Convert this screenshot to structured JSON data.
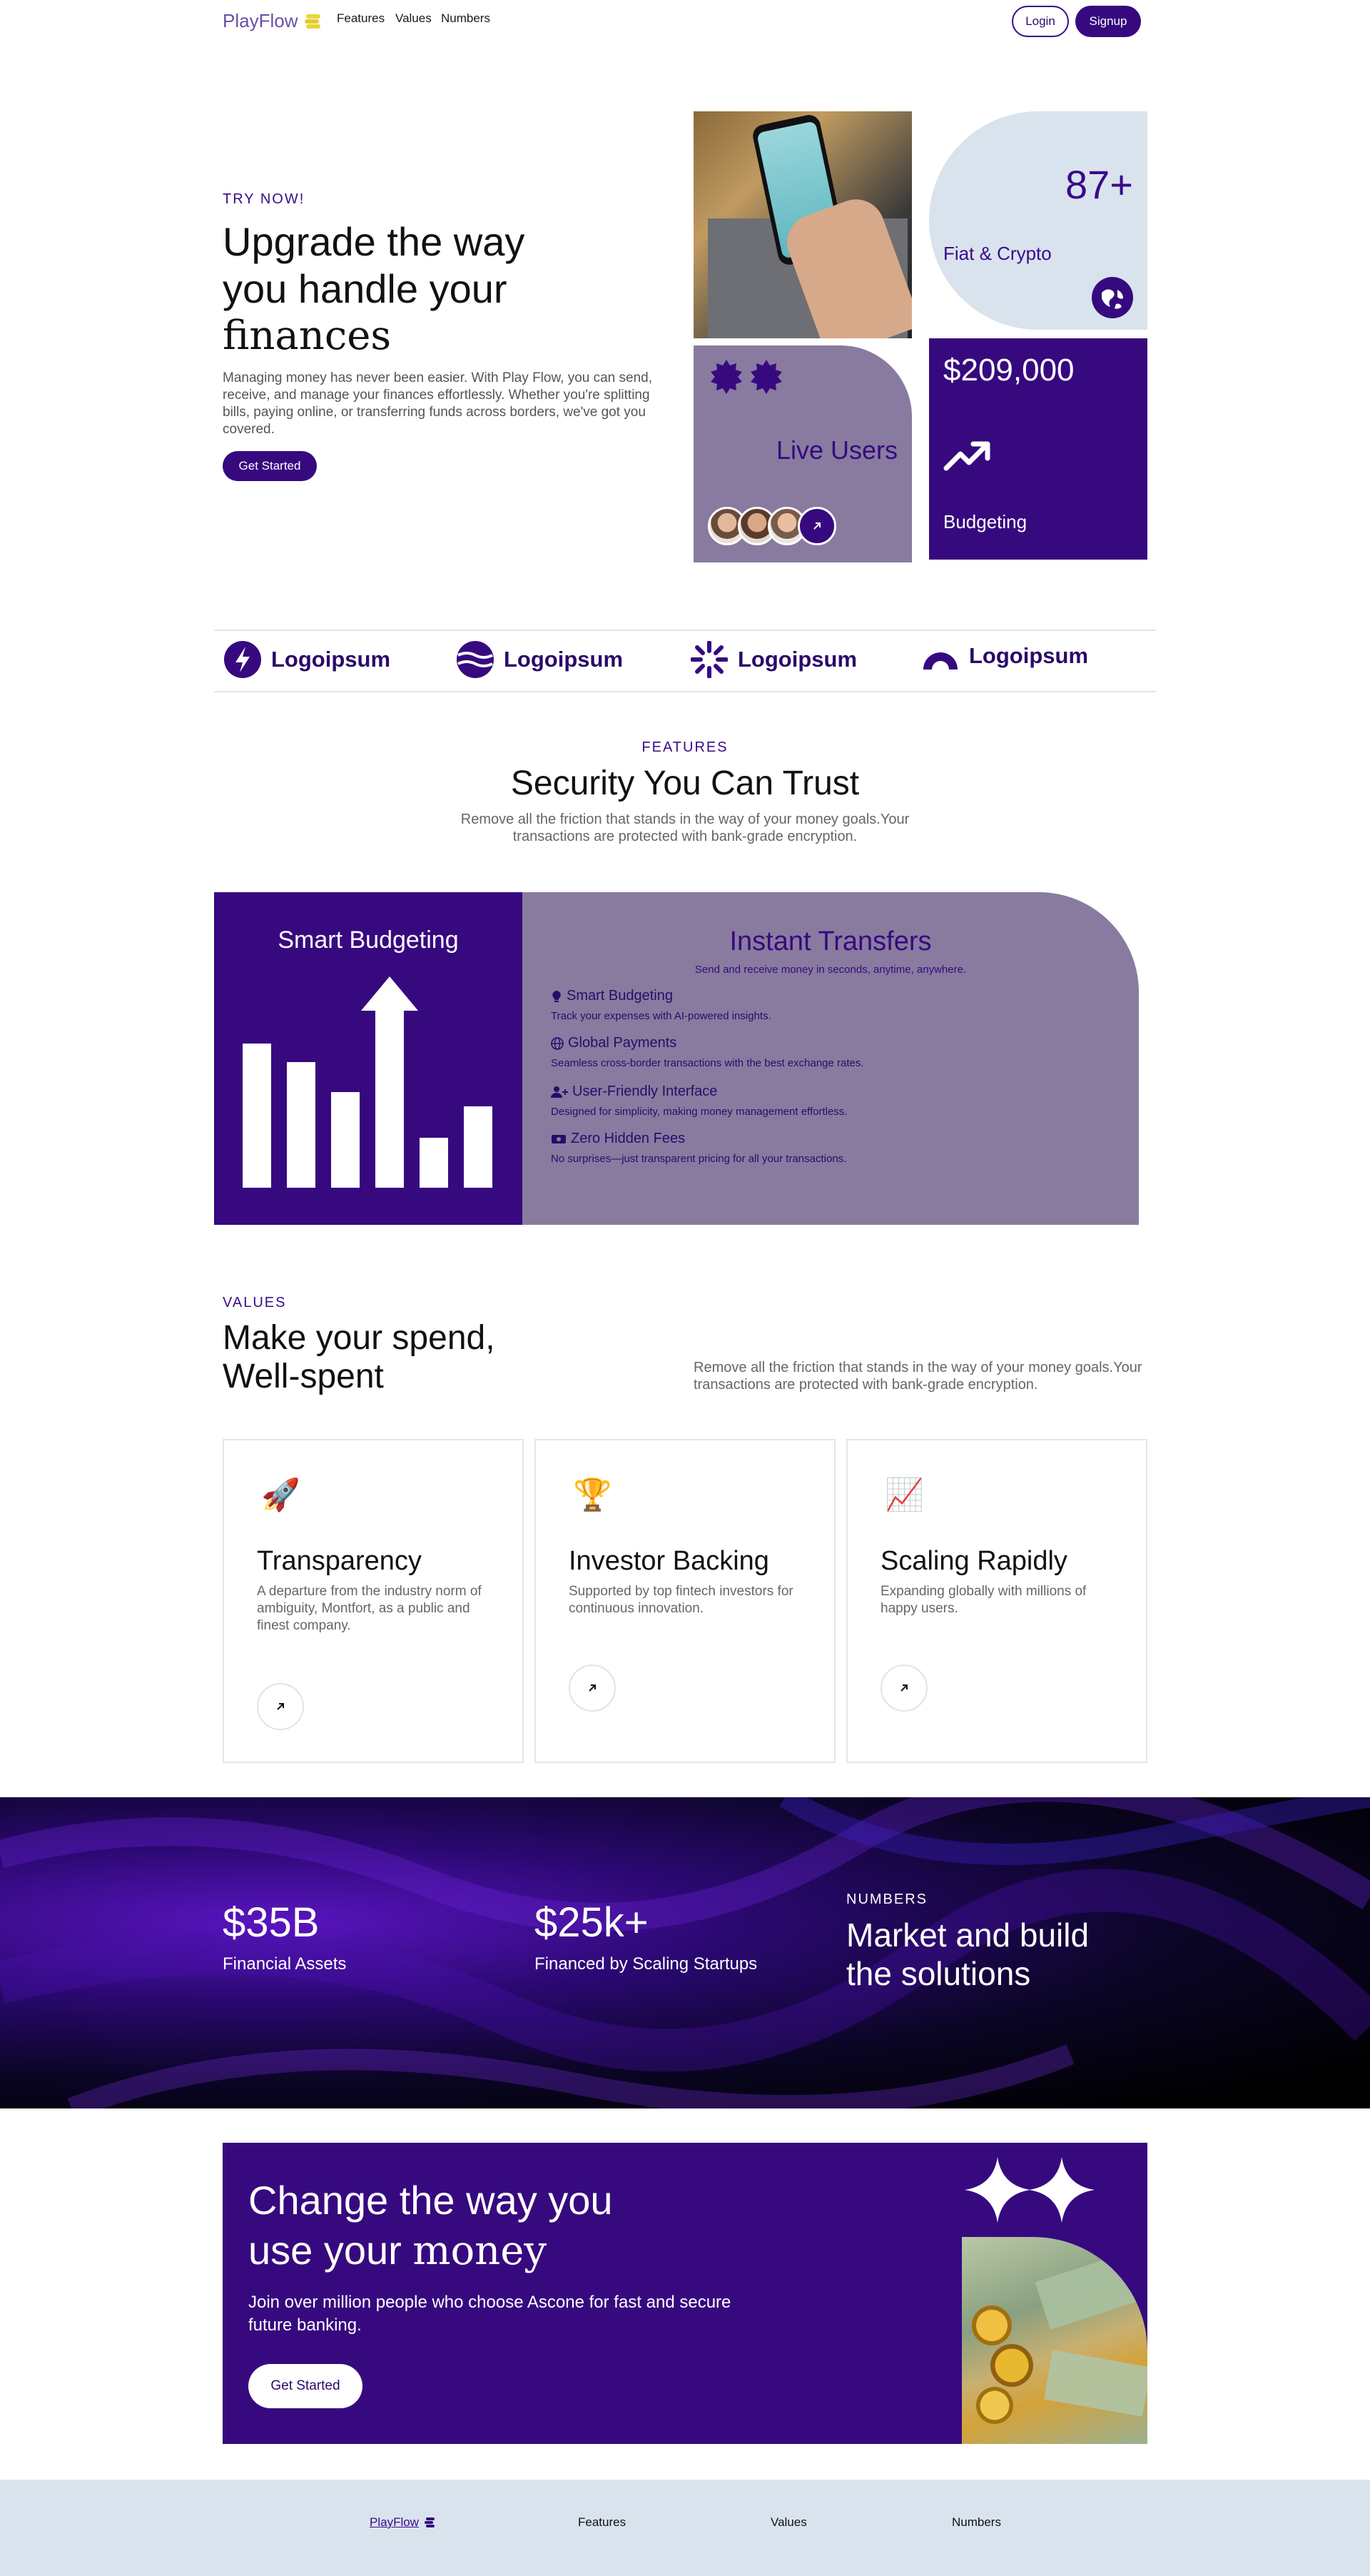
{
  "nav": {
    "brand": "PlayFlow",
    "links": [
      "Features",
      "Values",
      "Numbers"
    ],
    "login": "Login",
    "signup": "Signup"
  },
  "hero": {
    "eyebrow": "TRY NOW!",
    "title_line1": "Upgrade the way",
    "title_line2": "you handle your",
    "title_line3": "finances",
    "description": "Managing money has never been easier. With Play Flow, you can send, receive, and manage your finances effortlessly. Whether you're splitting bills, paying online, or transferring funds across borders, we've got you covered.",
    "cta": "Get Started",
    "stat_users": "87+",
    "stat_users_label": "Fiat & Crypto",
    "live_users_label": "Live Users",
    "budget_amount": "$209,000",
    "budget_label": "Budgeting"
  },
  "logos": [
    "Logoipsum",
    "Logoipsum",
    "Logoipsum",
    "Logoipsum"
  ],
  "features": {
    "eyebrow": "FEATURES",
    "title": "Security You Can Trust",
    "subtitle": "Remove all the friction that stands in the way of your money goals.Your transactions are protected with bank-grade encryption.",
    "smart_budgeting_title": "Smart Budgeting",
    "instant_title": "Instant Transfers",
    "instant_sub": "Send and receive money in seconds, anytime, anywhere.",
    "items": [
      {
        "title": "Smart Budgeting",
        "desc": "Track your expenses with AI-powered insights.",
        "icon": "lightbulb-icon"
      },
      {
        "title": "Global Payments",
        "desc": "Seamless cross-border transactions with the best exchange rates.",
        "icon": "globe-icon"
      },
      {
        "title": "User-Friendly Interface",
        "desc": "Designed for simplicity, making money management effortless.",
        "icon": "user-plus-icon"
      },
      {
        "title": "Zero Hidden Fees",
        "desc": "No surprises—just transparent pricing for all your transactions.",
        "icon": "money-icon"
      }
    ]
  },
  "values": {
    "eyebrow": "VALUES",
    "title_line1": "Make your spend,",
    "title_line2": "Well-spent",
    "subtitle": "Remove all the friction that stands in the way of your money goals.Your transactions are protected with bank-grade encryption.",
    "cards": [
      {
        "icon": "rocket-icon",
        "emoji": "🚀",
        "title": "Transparency",
        "desc": "A departure from the industry norm of ambiguity, Montfort, as a public and finest company."
      },
      {
        "icon": "trophy-icon",
        "emoji": "🏆",
        "title": "Investor Backing",
        "desc": "Supported by top fintech investors for continuous innovation."
      },
      {
        "icon": "chart-icon",
        "emoji": "📈",
        "title": "Scaling Rapidly",
        "desc": "Expanding globally with millions of happy users."
      }
    ]
  },
  "numbers": {
    "stat1_value": "$35B",
    "stat1_label": "Financial Assets",
    "stat2_value": "$25k+",
    "stat2_label": "Financed by Scaling Startups",
    "eyebrow": "NUMBERS",
    "title_line1": "Market and build",
    "title_line2": "the solutions"
  },
  "cta": {
    "title_line1": "Change the way you",
    "title_line2a": "use your ",
    "title_line2b": "money",
    "description": "Join over million people who choose Ascone for fast and secure future banking.",
    "button": "Get Started"
  },
  "footer": {
    "brand": "PlayFlow",
    "links": [
      "Features",
      "Values",
      "Numbers"
    ]
  },
  "colors": {
    "primary": "#37097f",
    "lilac": "#887b9f",
    "light_blue": "#d9e3ed"
  }
}
